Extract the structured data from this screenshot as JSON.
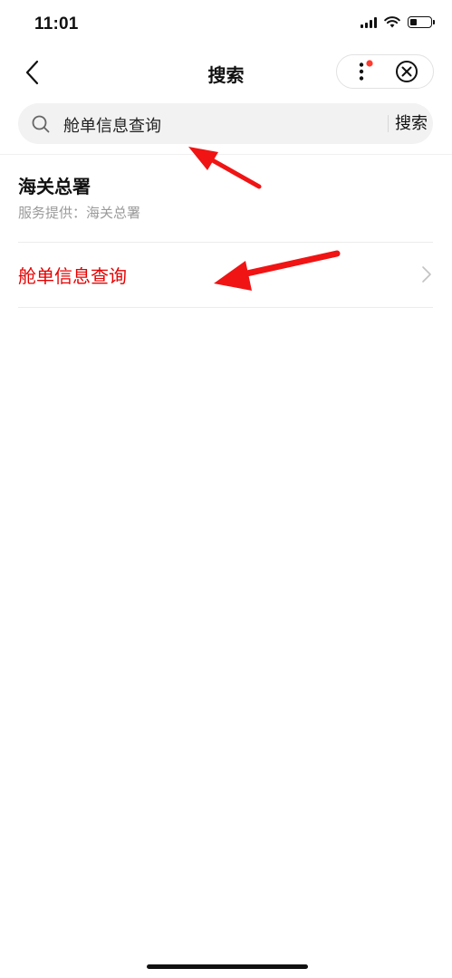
{
  "status_bar": {
    "time": "11:01",
    "battery_level": 0.35
  },
  "nav": {
    "title": "搜索",
    "back_icon": "chevron-left-icon",
    "more_icon": "more-vertical-icon",
    "close_icon": "circle-close-icon",
    "notification_dot_color": "#ff3b30"
  },
  "search": {
    "value": "舱单信息查询",
    "button_label": "搜索"
  },
  "results": {
    "org_name": "海关总署",
    "provider_text": "服务提供：海关总署",
    "items": [
      {
        "label": "舱单信息查询"
      }
    ]
  },
  "colors": {
    "accent_red": "#e60000",
    "arrow_red": "#f01414"
  }
}
